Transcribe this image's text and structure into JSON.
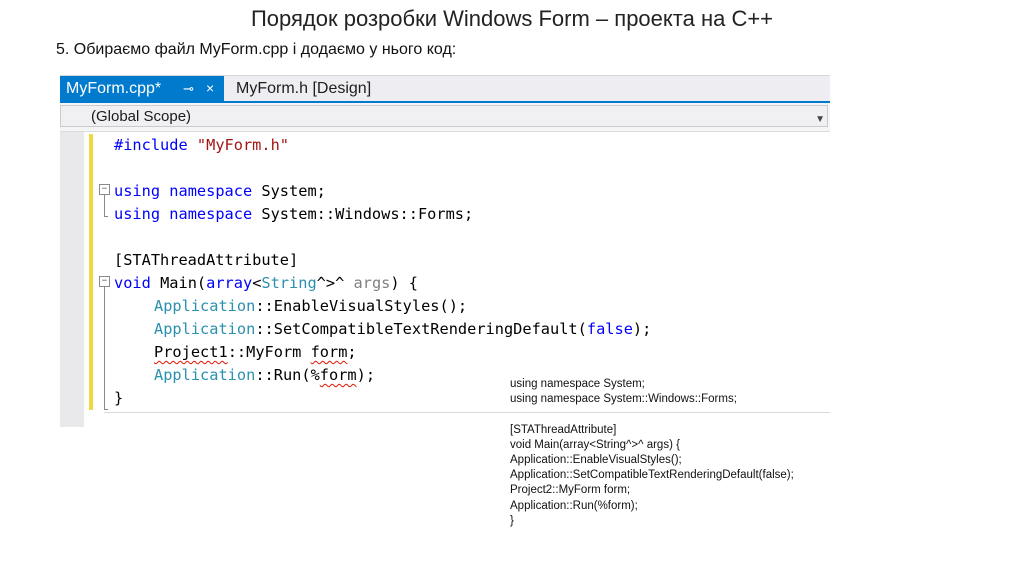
{
  "slide": {
    "title": "Порядок розробки  Windows Form – проекта на С++",
    "step": "5. Обираємо файл MyForm.cpp і додаємо у нього код:"
  },
  "editor": {
    "tabs": [
      {
        "label": "MyForm.cpp*",
        "active": true,
        "pin_icon": "pin-icon",
        "close_icon": "close-icon"
      },
      {
        "label": "MyForm.h [Design]",
        "active": false
      }
    ],
    "scope": {
      "value": "(Global Scope)",
      "icon": "chevron-down-icon"
    },
    "colors": {
      "accent": "#007acc",
      "keyword": "#0000ff",
      "string": "#a31515",
      "type": "#2b91af",
      "param": "#808080",
      "change_bar": "#f0d840"
    },
    "code": {
      "l1": {
        "kw": "#include",
        "str": "\"MyForm.h\""
      },
      "l3": {
        "kw1": "using",
        "kw2": "namespace",
        "rest": "System;"
      },
      "l4": {
        "kw1": "using",
        "kw2": "namespace",
        "rest": "System::Windows::Forms;"
      },
      "l6": {
        "text": "[STAThreadAttribute]"
      },
      "l7": {
        "kw": "void",
        "fn": "Main(",
        "type1": "array",
        "lt": "<",
        "type2": "String",
        "hat": "^>^",
        "param": "args",
        "close": ") {"
      },
      "l8": {
        "type": "Application",
        "rest": "::EnableVisualStyles();"
      },
      "l9": {
        "type": "Application",
        "rest": "::SetCompatibleTextRenderingDefault(",
        "kw": "false",
        "close": ");"
      },
      "l10": {
        "ns": "Project1",
        "mid": "::MyForm ",
        "var": "form",
        "end": ";"
      },
      "l11": {
        "type": "Application",
        "mid": "::Run(%",
        "var": "form",
        "end": ");"
      },
      "l12": {
        "text": "}"
      }
    }
  },
  "overlay": {
    "lines": [
      "using namespace System;",
      "using namespace System::Windows::Forms;",
      "",
      "[STAThreadAttribute]",
      "void Main(array<String^>^ args) {",
      "Application::EnableVisualStyles();",
      "Application::SetCompatibleTextRenderingDefault(false);",
      "Project2::MyForm form;",
      "Application::Run(%form);",
      "}"
    ]
  }
}
